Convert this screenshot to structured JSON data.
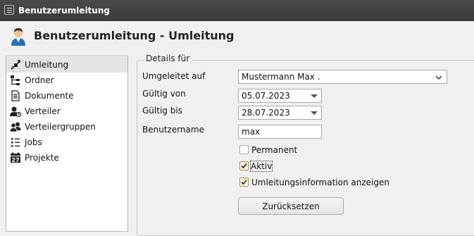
{
  "window": {
    "title": "Benutzerumleitung"
  },
  "header": {
    "title": "Benutzerumleitung - Umleitung"
  },
  "sidebar": {
    "items": [
      {
        "label": "Umleitung",
        "icon": "redirect-icon",
        "selected": true
      },
      {
        "label": "Ordner",
        "icon": "folder-tree-icon"
      },
      {
        "label": "Dokumente",
        "icon": "document-icon"
      },
      {
        "label": "Verteiler",
        "icon": "distributor-icon"
      },
      {
        "label": "Verteilergruppen",
        "icon": "user-group-icon"
      },
      {
        "label": "Jobs",
        "icon": "job-list-icon"
      },
      {
        "label": "Projekte",
        "icon": "calendar-icon"
      }
    ],
    "calendar_day": "27"
  },
  "details": {
    "legend": "Details für",
    "umgeleitet_auf": {
      "label": "Umgeleitet auf",
      "value": "Mustermann Max ."
    },
    "gueltig_von": {
      "label": "Gültig von",
      "value": "05.07.2023"
    },
    "gueltig_bis": {
      "label": "Gültig bis",
      "value": "28.07.2023"
    },
    "benutzername": {
      "label": "Benutzername",
      "value": "max"
    },
    "permanent": {
      "label": "Permanent",
      "checked": false
    },
    "aktiv": {
      "label": "Aktiv",
      "checked": true
    },
    "umleitungsinfo": {
      "label": "Umleitungsinformation anzeigen",
      "checked": true
    },
    "reset_button": "Zurücksetzen"
  },
  "colors": {
    "titlebar": "#3f3f3f",
    "selection": "#e4e4e4",
    "checkbox_checked_bg": "#faf4dc"
  }
}
